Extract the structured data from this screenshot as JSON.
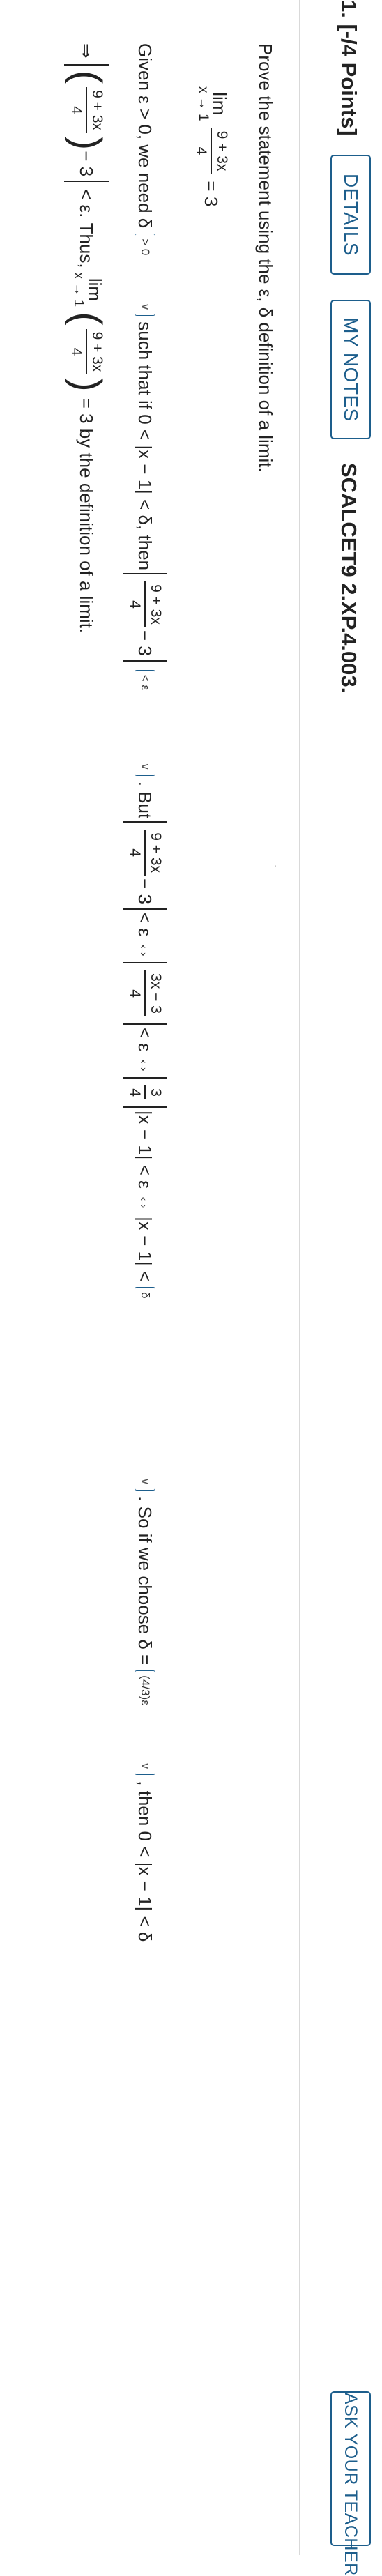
{
  "header": {
    "question_number": "1. [-/4 Points]",
    "details_label": "DETAILS",
    "my_notes_label": "MY NOTES",
    "problem_code": "SCALCET9 2.XP.4.003.",
    "ask_teacher_label": "ASK YOUR TEACHER"
  },
  "problem": {
    "prompt": "Prove the statement using the ε, δ definition of a limit.",
    "limit": {
      "lim_word": "lim",
      "subscript": "x → 1",
      "numerator": "9 + 3x",
      "denominator": "4",
      "equals": "= 3"
    }
  },
  "proof": {
    "t1": "Given ε > 0, we need δ",
    "t2": "such that if 0 < |x − 1| < δ, then",
    "t3": "− 3",
    "t4": ". But",
    "t5": "− 3",
    "t6": "< ε ⇔",
    "t7": "< ε ⇔",
    "t8": "|x − 1| < ε ⇔ |x − 1| <",
    "t9": ". So if we choose δ =",
    "t10": ", then 0 < |x − 1| < δ",
    "frac_a_num": "9 + 3x",
    "frac_a_den": "4",
    "frac_b_num": "9 + 3x",
    "frac_b_den": "4",
    "frac_c_num": "3x − 3",
    "frac_c_den": "4",
    "frac_d_num": "3",
    "frac_d_den": "4",
    "dropdown_1": {
      "value": "> 0"
    },
    "dropdown_2": {
      "value": "< ε"
    },
    "dropdown_3": {
      "value": "δ"
    },
    "dropdown_4": {
      "value": "(4/3)ε"
    },
    "chevron": "∨"
  },
  "conclusion": {
    "arrow": "⇒",
    "frac_num": "9 + 3x",
    "frac_den": "4",
    "minus": "− 3",
    "lt_eps": "< ε. Thus,",
    "lim_word": "lim",
    "lim_sub": "x → 1",
    "lim_num": "9 + 3x",
    "lim_den": "4",
    "end": "= 3 by the definition of a limit."
  }
}
